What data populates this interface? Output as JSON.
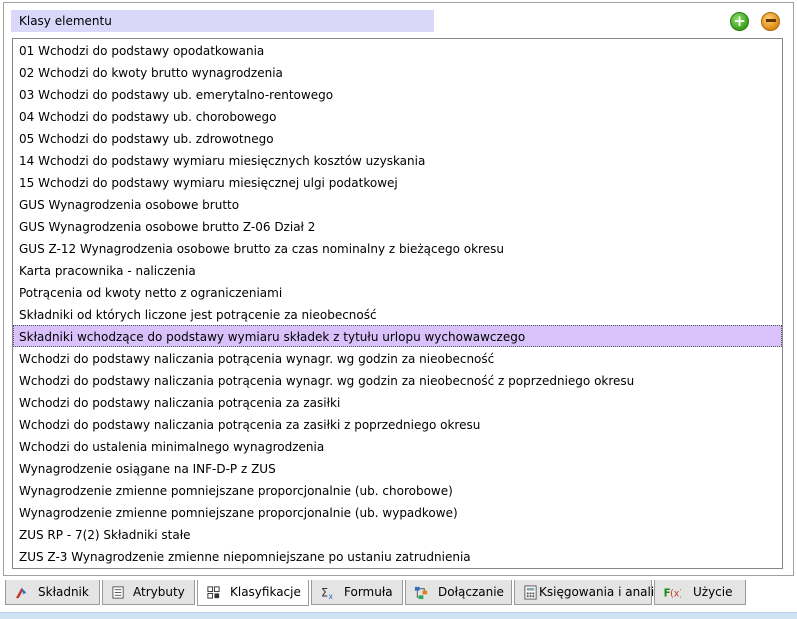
{
  "header": {
    "title": "Klasy elementu",
    "add_icon": "plus-circle-icon",
    "remove_icon": "minus-circle-icon"
  },
  "list": {
    "items": [
      "01 Wchodzi do podstawy opodatkowania",
      "02 Wchodzi do kwoty brutto wynagrodzenia",
      "03 Wchodzi do podstawy ub. emerytalno-rentowego",
      "04 Wchodzi do podstawy ub. chorobowego",
      "05 Wchodzi do podstawy ub. zdrowotnego",
      "14 Wchodzi do podstawy wymiaru miesięcznych kosztów uzyskania",
      "15 Wchodzi do podstawy wymiaru miesięcznej ulgi podatkowej",
      "GUS Wynagrodzenia osobowe brutto",
      "GUS Wynagrodzenia osobowe brutto Z-06 Dział 2",
      "GUS Z-12 Wynagrodzenia osobowe brutto za czas nominalny z bieżącego okresu",
      "Karta pracownika - naliczenia",
      "Potrącenia od kwoty netto z ograniczeniami",
      "Składniki od których liczone jest potrącenie za nieobecność",
      "Składniki wchodzące do podstawy wymiaru składek z tytułu urlopu wychowawczego",
      "Wchodzi do podstawy naliczania potrącenia wynagr. wg godzin za nieobecność",
      "Wchodzi do podstawy naliczania potrącenia wynagr. wg godzin za nieobecność z poprzedniego okresu",
      "Wchodzi do podstawy naliczania potrącenia za zasiłki",
      "Wchodzi do podstawy naliczania potrącenia za zasiłki z poprzedniego okresu",
      "Wchodzi do ustalenia minimalnego wynagrodzenia",
      "Wynagrodzenie osiągane na INF-D-P z ZUS",
      "Wynagrodzenie zmienne pomniejszane proporcjonalnie (ub. chorobowe)",
      "Wynagrodzenie zmienne pomniejszane proporcjonalnie (ub. wypadkowe)",
      "ZUS RP - 7(2) Składniki stałe",
      "ZUS Z-3 Wynagrodzenie zmienne niepomniejszane po ustaniu zatrudnienia"
    ],
    "selected_index": 13,
    "selected_color": "#d9c2fb"
  },
  "tabs": [
    {
      "label": "Składnik",
      "icon": "skladnik-icon"
    },
    {
      "label": "Atrybuty",
      "icon": "atrybuty-icon"
    },
    {
      "label": "Klasyfikacje",
      "icon": "klasyfikacje-icon",
      "active": true
    },
    {
      "label": "Formuła",
      "icon": "formula-icon"
    },
    {
      "label": "Dołączanie",
      "icon": "dolaczanie-icon"
    },
    {
      "label": "Księgowania i analizy",
      "icon": "ksiegowania-icon"
    },
    {
      "label": "Użycie",
      "icon": "uzycie-icon"
    }
  ],
  "colors": {
    "header_bg": "#d9d8fb",
    "tab_bg": "#e4e4e4",
    "accent_green": "#3d9f1c",
    "accent_orange": "#e08a10"
  }
}
